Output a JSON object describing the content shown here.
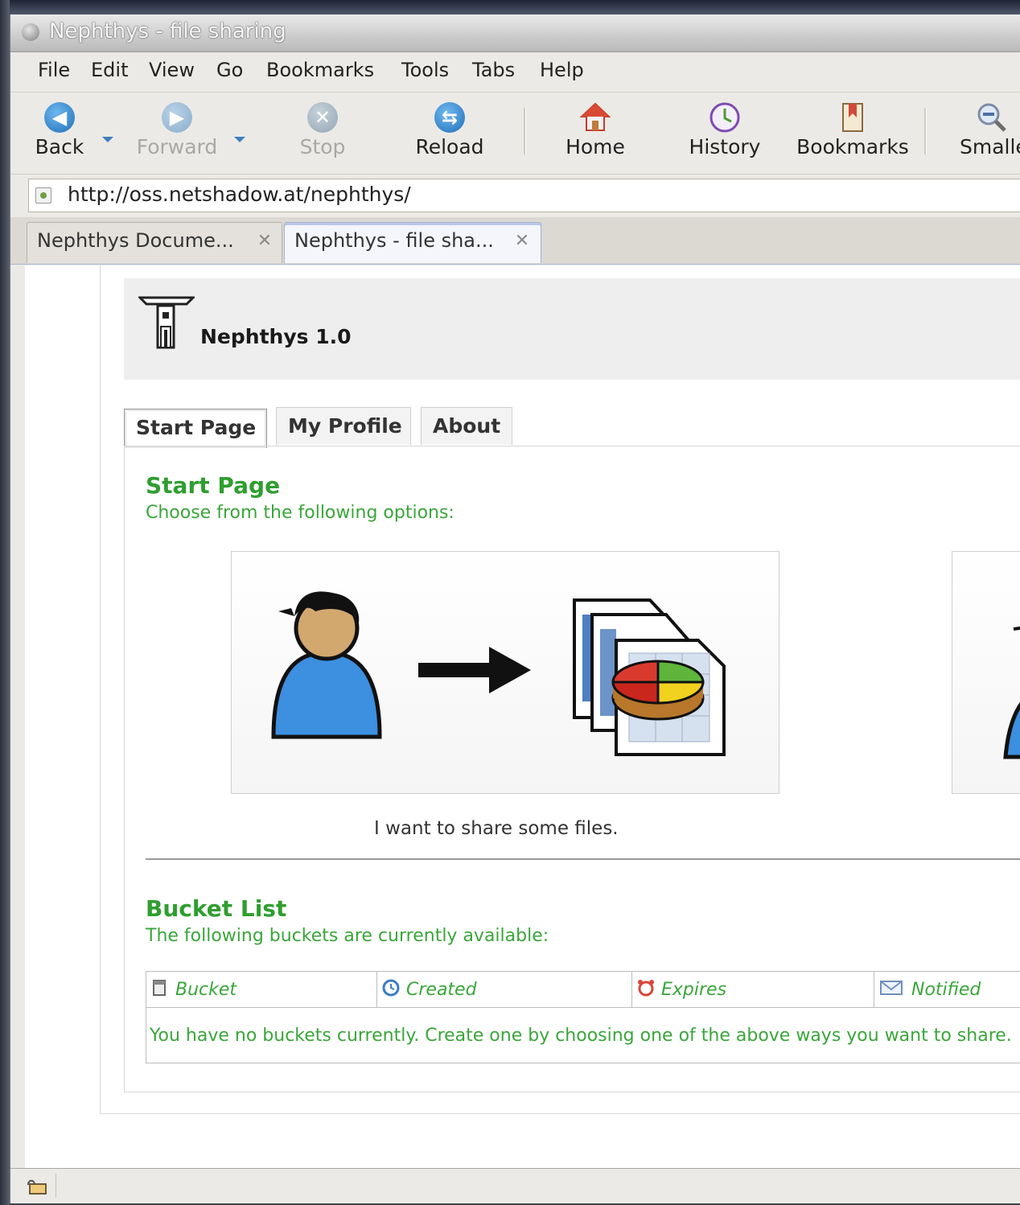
{
  "window": {
    "title": "Nephthys - file sharing"
  },
  "menu": [
    "File",
    "Edit",
    "View",
    "Go",
    "Bookmarks",
    "Tools",
    "Tabs",
    "Help"
  ],
  "toolbar": {
    "back": "Back",
    "forward": "Forward",
    "stop": "Stop",
    "reload": "Reload",
    "home": "Home",
    "history": "History",
    "bookmarks": "Bookmarks",
    "smaller": "Smaller"
  },
  "address": {
    "url": "http://oss.netshadow.at/nephthys/"
  },
  "browser_tabs": [
    {
      "title": "Nephthys Docume...",
      "active": false
    },
    {
      "title": "Nephthys - file sha...",
      "active": true
    }
  ],
  "app": {
    "title": "Nephthys 1.0"
  },
  "page_tabs": [
    "Start Page",
    "My Profile",
    "About"
  ],
  "start": {
    "heading": "Start Page",
    "subtitle": "Choose from the following options:",
    "option1_caption": "I want to share some files."
  },
  "buckets": {
    "heading": "Bucket List",
    "subtitle": "The following buckets are currently available:",
    "columns": [
      "Bucket",
      "Created",
      "Expires",
      "Notified"
    ],
    "empty_message": "You have no buckets currently. Create one by choosing one of the above ways you want to share."
  },
  "colors": {
    "accent_green": "#2f9e2f",
    "tab_active": "#9fb2d4"
  }
}
